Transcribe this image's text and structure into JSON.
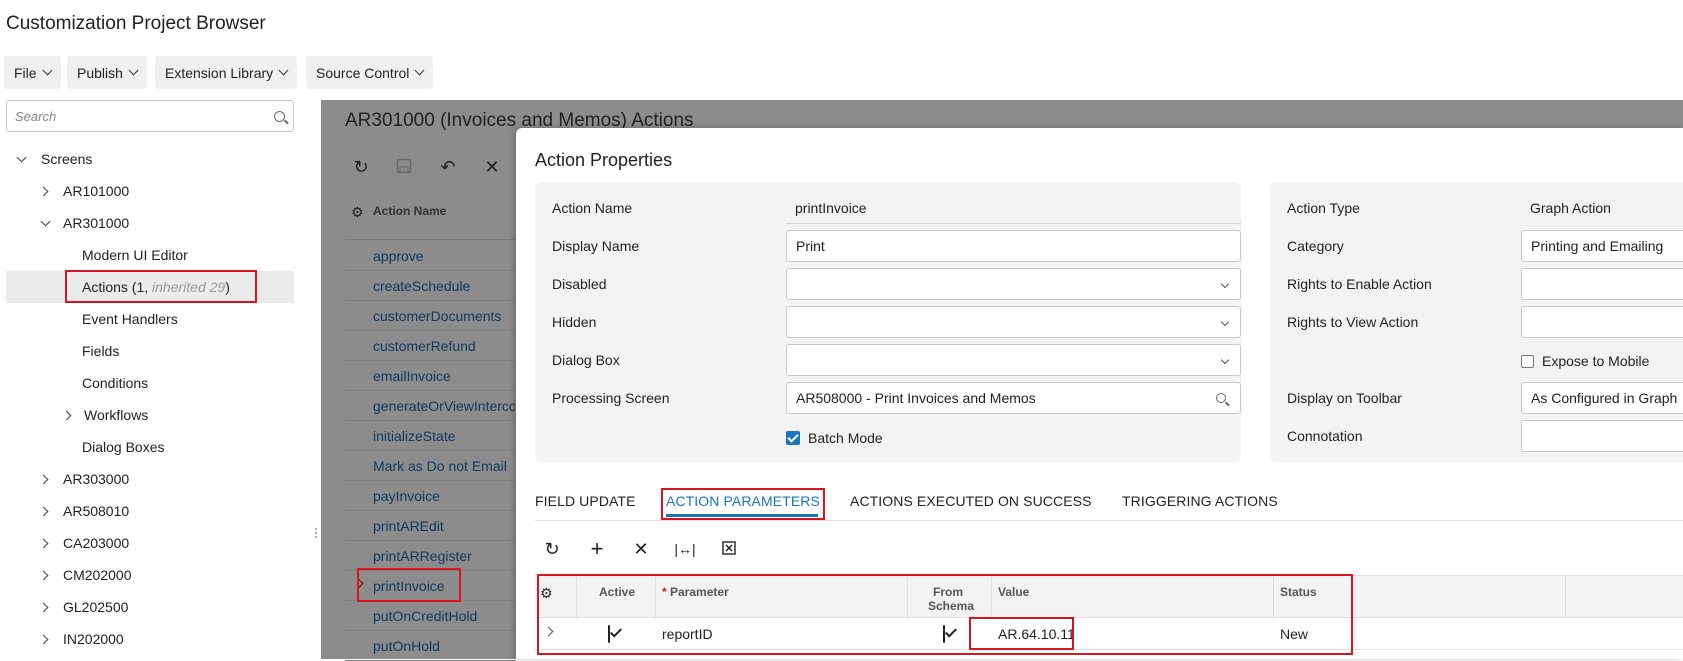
{
  "app": {
    "title": "Customization Project Browser"
  },
  "menu": [
    {
      "label": "File"
    },
    {
      "label": "Publish"
    },
    {
      "label": "Extension Library"
    },
    {
      "label": "Source Control"
    }
  ],
  "sidebar": {
    "search_placeholder": "Search",
    "tree": {
      "screens": "Screens",
      "ar101000": "AR101000",
      "ar301000": "AR301000",
      "modern_ui": "Modern UI Editor",
      "actions_prefix": "Actions (1, ",
      "actions_inherited": "inherited 29",
      "actions_suffix": ")",
      "event_handlers": "Event Handlers",
      "fields": "Fields",
      "conditions": "Conditions",
      "workflows": "Workflows",
      "dialog_boxes": "Dialog Boxes",
      "ar303000": "AR303000",
      "ar508010": "AR508010",
      "ca203000": "CA203000",
      "cm202000": "CM202000",
      "gl202500": "GL202500",
      "in202000": "IN202000"
    }
  },
  "background": {
    "title": "AR301000 (Invoices and Memos) Actions",
    "grid_header": "Action Name",
    "actions": [
      "approve",
      "createSchedule",
      "customerDocuments",
      "customerRefund",
      "emailInvoice",
      "generateOrViewIntercompany",
      "initializeState",
      "Mark as Do not Email",
      "payInvoice",
      "printAREdit",
      "printARRegister",
      "printInvoice",
      "putOnCreditHold",
      "putOnHold"
    ]
  },
  "dialog": {
    "title": "Action Properties",
    "left": {
      "action_name_label": "Action Name",
      "action_name_value": "printInvoice",
      "display_name_label": "Display Name",
      "display_name_value": "Print",
      "disabled_label": "Disabled",
      "hidden_label": "Hidden",
      "dialog_box_label": "Dialog Box",
      "processing_screen_label": "Processing Screen",
      "processing_screen_value": "AR508000 - Print Invoices and Memos",
      "batch_mode_label": "Batch Mode"
    },
    "right": {
      "action_type_label": "Action Type",
      "action_type_value": "Graph Action",
      "category_label": "Category",
      "category_value": "Printing and Emailing",
      "rights_enable_label": "Rights to Enable Action",
      "rights_view_label": "Rights to View Action",
      "expose_mobile_label": "Expose to Mobile",
      "display_toolbar_label": "Display on Toolbar",
      "display_toolbar_value": "As Configured in Graph",
      "connotation_label": "Connotation"
    },
    "tabs": [
      {
        "label": "FIELD UPDATE"
      },
      {
        "label": "ACTION PARAMETERS"
      },
      {
        "label": "ACTIONS EXECUTED ON SUCCESS"
      },
      {
        "label": "TRIGGERING ACTIONS"
      }
    ],
    "grid": {
      "headers": {
        "active": "Active",
        "required_mark": "*",
        "parameter": "Parameter",
        "from_schema_1": "From",
        "from_schema_2": "Schema",
        "value": "Value",
        "status": "Status"
      },
      "rows": [
        {
          "parameter": "reportID",
          "value": "AR.64.10.11",
          "status": "New"
        }
      ]
    }
  },
  "colors": {
    "accent": "#1a74c4",
    "highlight": "#d9141e",
    "overlay": "#8c8c8c"
  }
}
